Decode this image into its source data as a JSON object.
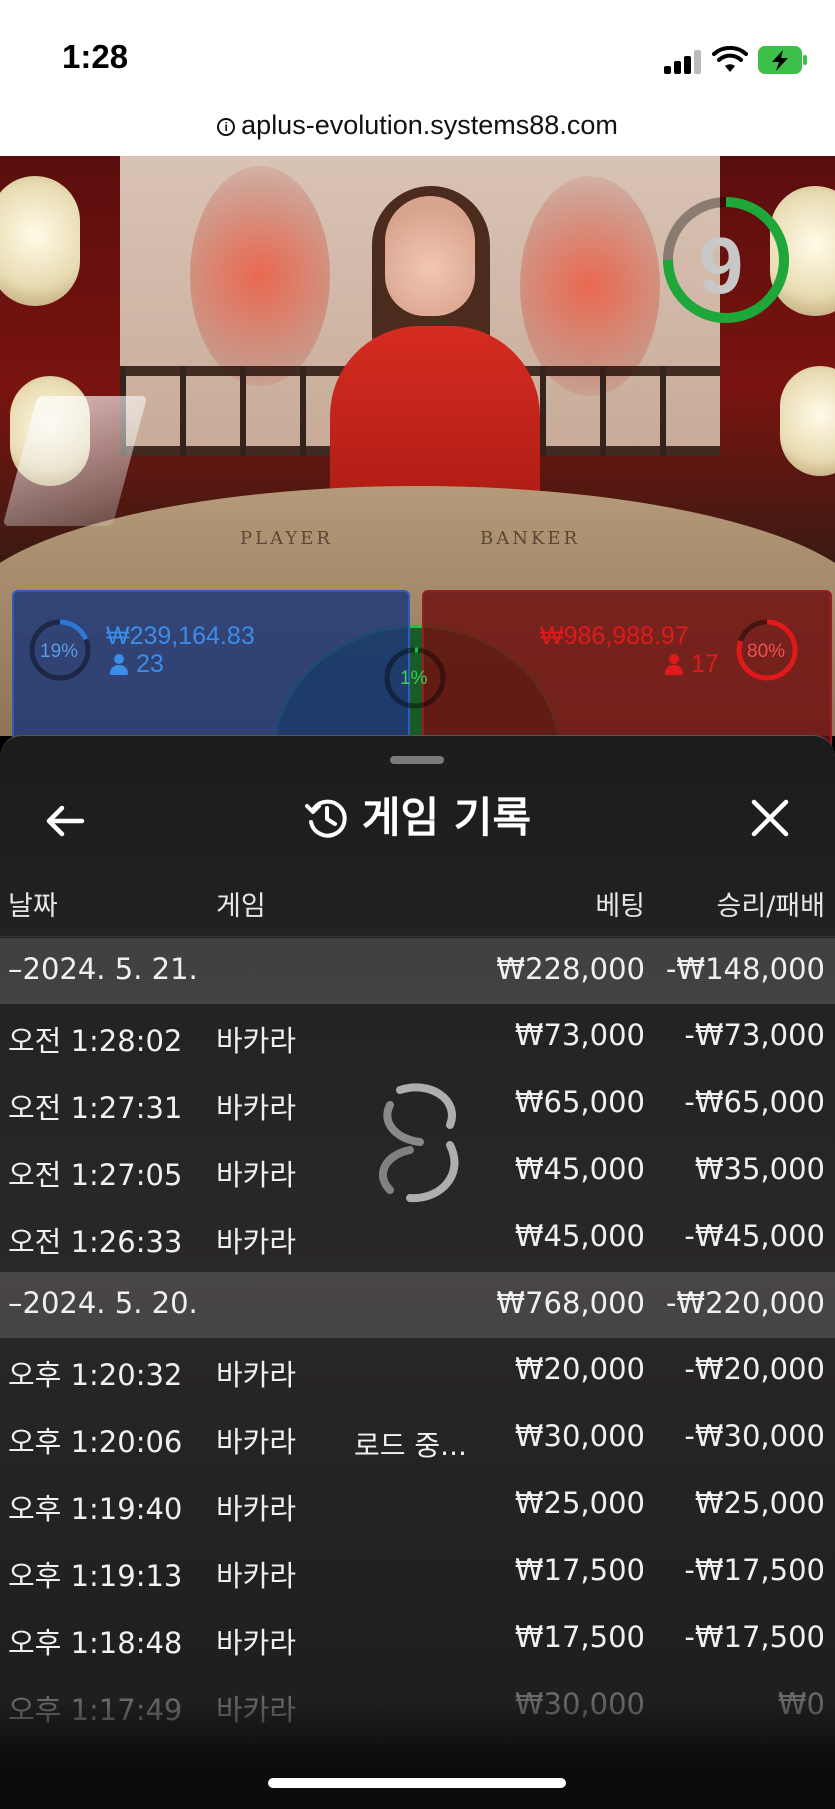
{
  "status_bar": {
    "time": "1:28"
  },
  "browser": {
    "url": "aplus-evolution.systems88.com"
  },
  "live": {
    "timer": "9",
    "timer_fraction": 0.75,
    "table_labels": [
      "PLAYER",
      "BANKER"
    ],
    "player": {
      "percent": "19%",
      "amount": "₩239,164.83",
      "count": "23"
    },
    "tie": {
      "percent": "1%"
    },
    "banker": {
      "percent": "80%",
      "amount": "₩986,988.97",
      "count": "17"
    },
    "colors": {
      "player": "#2b78d6",
      "banker": "#e0191b",
      "tie": "#2db84c",
      "timer": "#1fa83a"
    }
  },
  "history": {
    "title": "게임 기록",
    "columns": {
      "date": "날짜",
      "game": "게임",
      "bet": "베팅",
      "result": "승리/패배"
    },
    "rows": [
      {
        "group": true,
        "date": "–2024. 5. 21.",
        "game": "",
        "bet": "₩228,000",
        "result": "-₩148,000"
      },
      {
        "group": false,
        "date": "오전 1:28:02",
        "game": "바카라",
        "bet": "₩73,000",
        "result": "-₩73,000"
      },
      {
        "group": false,
        "date": "오전 1:27:31",
        "game": "바카라",
        "bet": "₩65,000",
        "result": "-₩65,000"
      },
      {
        "group": false,
        "date": "오전 1:27:05",
        "game": "바카라",
        "bet": "₩45,000",
        "result": "₩35,000"
      },
      {
        "group": false,
        "date": "오전 1:26:33",
        "game": "바카라",
        "bet": "₩45,000",
        "result": "-₩45,000"
      },
      {
        "group": true,
        "date": "–2024. 5. 20.",
        "game": "",
        "bet": "₩768,000",
        "result": "-₩220,000"
      },
      {
        "group": false,
        "date": "오후 1:20:32",
        "game": "바카라",
        "bet": "₩20,000",
        "result": "-₩20,000"
      },
      {
        "group": false,
        "date": "오후 1:20:06",
        "game": "바카라",
        "bet": "₩30,000",
        "result": "-₩30,000"
      },
      {
        "group": false,
        "date": "오후 1:19:40",
        "game": "바카라",
        "bet": "₩25,000",
        "result": "₩25,000"
      },
      {
        "group": false,
        "date": "오후 1:19:13",
        "game": "바카라",
        "bet": "₩17,500",
        "result": "-₩17,500"
      },
      {
        "group": false,
        "date": "오후 1:18:48",
        "game": "바카라",
        "bet": "₩17,500",
        "result": "-₩17,500"
      },
      {
        "group": false,
        "date": "오후 1:17:49",
        "game": "바카라",
        "bet": "₩30,000",
        "result": "₩0"
      }
    ],
    "loading_text": "로드 중..."
  },
  "icons": {
    "back": "arrow-left-icon",
    "close": "close-icon",
    "history": "history-clock-icon",
    "loader": "spinner-icon",
    "info": "info-icon",
    "signal": "cellular-signal-icon",
    "wifi": "wifi-icon",
    "battery": "battery-charging-icon"
  }
}
